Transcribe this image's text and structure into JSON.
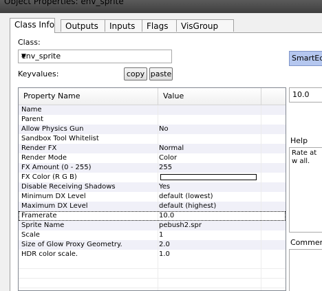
{
  "window": {
    "title": "Object Properties: env_sprite"
  },
  "tabs": [
    {
      "label": "Class Info",
      "active": true
    },
    {
      "label": "Outputs"
    },
    {
      "label": "Inputs"
    },
    {
      "label": "Flags"
    },
    {
      "label": "VisGroup"
    }
  ],
  "class_label": "Class:",
  "class_value": "env_sprite",
  "keyvalues_label": "Keyvalues:",
  "copy_label": "copy",
  "paste_label": "paste",
  "smartedit_label": "SmartEdit",
  "table": {
    "headers": [
      "Property Name",
      "Value"
    ],
    "rows": [
      {
        "name": "Name",
        "value": ""
      },
      {
        "name": "Parent",
        "value": ""
      },
      {
        "name": "Allow Physics Gun",
        "value": "No"
      },
      {
        "name": "Sandbox Tool Whitelist",
        "value": ""
      },
      {
        "name": "Render FX",
        "value": "Normal"
      },
      {
        "name": "Render Mode",
        "value": "Color"
      },
      {
        "name": "FX Amount (0 - 255)",
        "value": "255"
      },
      {
        "name": "FX Color (R G B)",
        "value": "",
        "color": "#ffffff"
      },
      {
        "name": "Disable Receiving Shadows",
        "value": "Yes"
      },
      {
        "name": "Minimum DX Level",
        "value": "default (lowest)"
      },
      {
        "name": "Maximum DX Level",
        "value": "default (highest)"
      },
      {
        "name": "Framerate",
        "value": "10.0",
        "selected": true
      },
      {
        "name": "Sprite Name",
        "value": "pebush2.spr"
      },
      {
        "name": "Scale",
        "value": "1"
      },
      {
        "name": "Size of Glow Proxy Geometry.",
        "value": "2.0"
      },
      {
        "name": "HDR color scale.",
        "value": "1.0"
      }
    ]
  },
  "value_field": "10.0",
  "help_label": "Help",
  "help_text": "Rate at w all.",
  "comments_label": "Comments"
}
